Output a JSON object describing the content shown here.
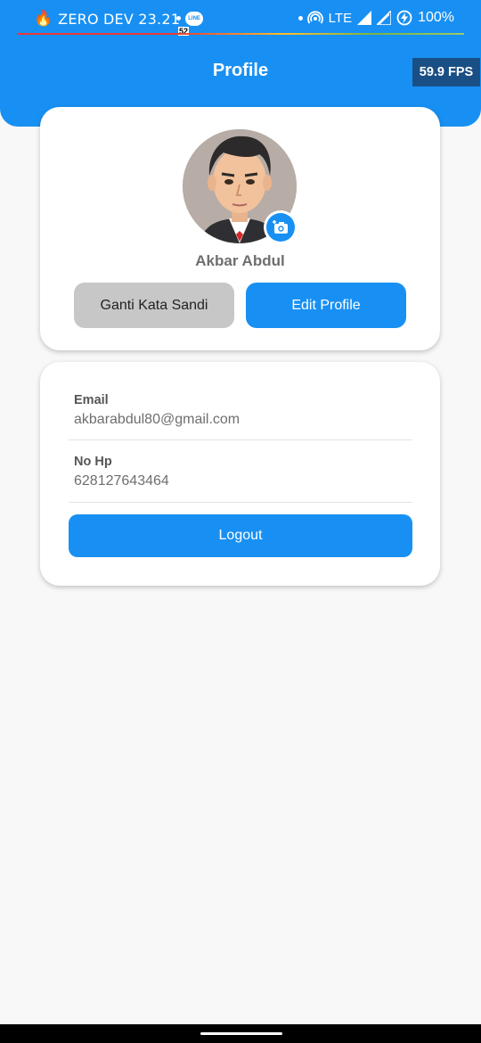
{
  "status_bar": {
    "carrier": "ZERO DEV 23.21",
    "line_badge": "LINE",
    "small_number": "52",
    "network": "LTE",
    "battery": "100%"
  },
  "header": {
    "title": "Profile",
    "fps": "59.9 FPS"
  },
  "profile": {
    "name": "Akbar Abdul",
    "change_password_label": "Ganti Kata Sandi",
    "edit_profile_label": "Edit Profile"
  },
  "info": {
    "email_label": "Email",
    "email_value": "akbarabdul80@gmail.com",
    "phone_label": "No Hp",
    "phone_value": "628127643464",
    "logout_label": "Logout"
  },
  "colors": {
    "accent": "#1890f3",
    "secondary_button": "#c7c7c7",
    "background": "#f8f8f8"
  }
}
